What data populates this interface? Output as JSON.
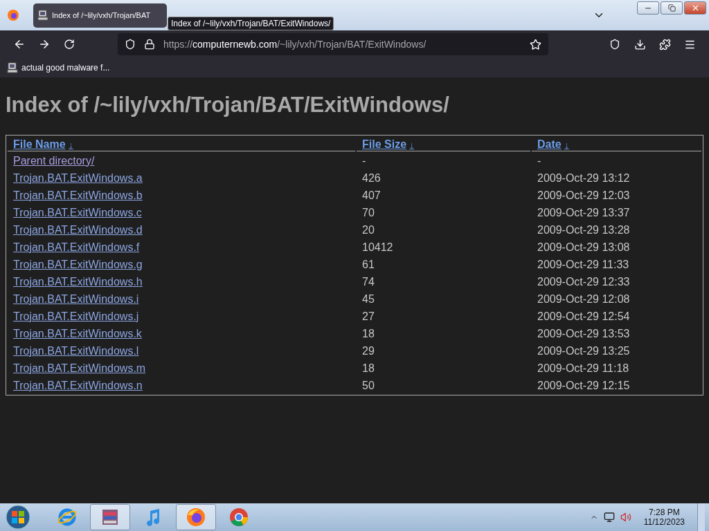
{
  "browser": {
    "tab": {
      "title": "Index of /~lily/vxh/Trojan/BAT",
      "selected": true
    },
    "tooltip": "Index of /~lily/vxh/Trojan/BAT/ExitWindows/",
    "address": {
      "scheme": "https://",
      "host": "computernewb.com",
      "path": "/~lily/vxh/Trojan/BAT/ExitWindows/"
    },
    "bookmarks": [
      "actual good malware f..."
    ]
  },
  "page": {
    "heading": "Index of /~lily/vxh/Trojan/BAT/ExitWindows/",
    "table": {
      "columns": [
        {
          "label": "File Name",
          "sort": "↓"
        },
        {
          "label": "File Size",
          "sort": "↓"
        },
        {
          "label": "Date",
          "sort": "↓"
        }
      ],
      "rows": [
        {
          "name": "Parent directory/",
          "size": "-",
          "date": "-",
          "visited": true
        },
        {
          "name": "Trojan.BAT.ExitWindows.a",
          "size": "426",
          "date": "2009-Oct-29 13:12",
          "visited": false
        },
        {
          "name": "Trojan.BAT.ExitWindows.b",
          "size": "407",
          "date": "2009-Oct-29 12:03",
          "visited": false
        },
        {
          "name": "Trojan.BAT.ExitWindows.c",
          "size": "70",
          "date": "2009-Oct-29 13:37",
          "visited": false
        },
        {
          "name": "Trojan.BAT.ExitWindows.d",
          "size": "20",
          "date": "2009-Oct-29 13:28",
          "visited": false
        },
        {
          "name": "Trojan.BAT.ExitWindows.f",
          "size": "10412",
          "date": "2009-Oct-29 13:08",
          "visited": false
        },
        {
          "name": "Trojan.BAT.ExitWindows.g",
          "size": "61",
          "date": "2009-Oct-29 11:33",
          "visited": false
        },
        {
          "name": "Trojan.BAT.ExitWindows.h",
          "size": "74",
          "date": "2009-Oct-29 12:33",
          "visited": false
        },
        {
          "name": "Trojan.BAT.ExitWindows.i",
          "size": "45",
          "date": "2009-Oct-29 12:08",
          "visited": false
        },
        {
          "name": "Trojan.BAT.ExitWindows.j",
          "size": "27",
          "date": "2009-Oct-29 12:54",
          "visited": false
        },
        {
          "name": "Trojan.BAT.ExitWindows.k",
          "size": "18",
          "date": "2009-Oct-29 13:53",
          "visited": false
        },
        {
          "name": "Trojan.BAT.ExitWindows.l",
          "size": "29",
          "date": "2009-Oct-29 13:25",
          "visited": false
        },
        {
          "name": "Trojan.BAT.ExitWindows.m",
          "size": "18",
          "date": "2009-Oct-29 11:18",
          "visited": false
        },
        {
          "name": "Trojan.BAT.ExitWindows.n",
          "size": "50",
          "date": "2009-Oct-29 12:15",
          "visited": false
        }
      ]
    }
  },
  "taskbar": {
    "apps": [
      {
        "kind": "ie",
        "open": false
      },
      {
        "kind": "archive",
        "open": true
      },
      {
        "kind": "music",
        "open": false
      },
      {
        "kind": "firefox",
        "open": true
      },
      {
        "kind": "chrome",
        "open": false
      }
    ],
    "clock": {
      "time": "7:28 PM",
      "date": "11/12/2023"
    }
  }
}
